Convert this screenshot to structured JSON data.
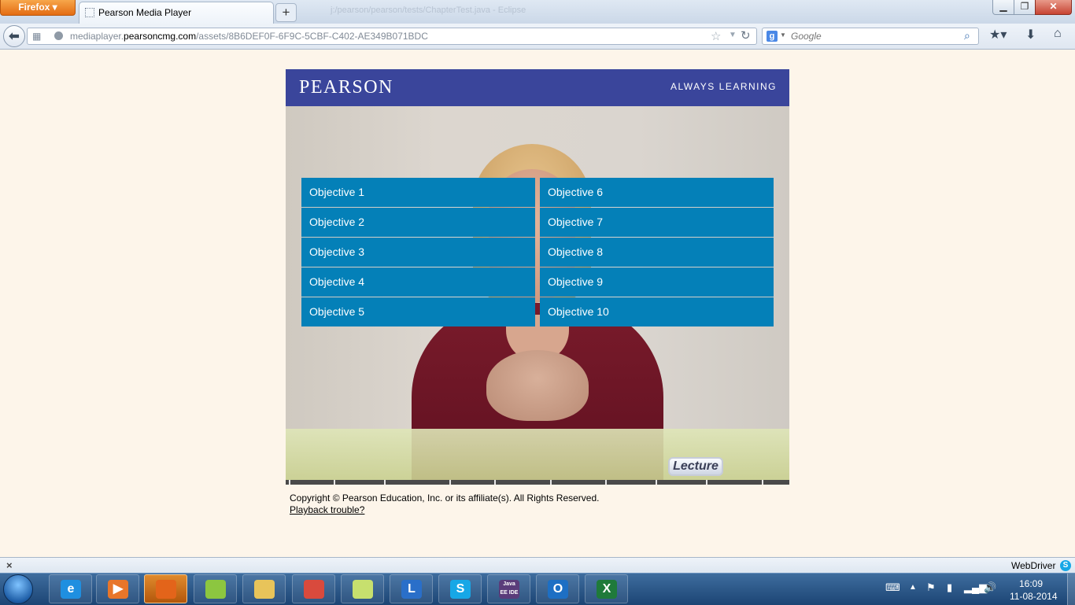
{
  "browser": {
    "menu_button": "Firefox",
    "tab_title": "Pearson Media Player",
    "new_tab": "+",
    "background_title": "j:/pearson/pearson/tests/ChapterTest.java - Eclipse",
    "url_prefix": "mediaplayer.",
    "url_domain": "pearsoncmg.com",
    "url_path": "/assets/8B6DEF0F-6F9C-5CBF-C402-AE349B071BDC",
    "search_placeholder": "Google",
    "search_engine_letter": "g"
  },
  "page": {
    "logo": "PEARSON",
    "tagline": "ALWAYS LEARNING",
    "objectives_left": [
      "Objective 1",
      "Objective 2",
      "Objective 3",
      "Objective 4",
      "Objective 5"
    ],
    "objectives_right": [
      "Objective 6",
      "Objective 7",
      "Objective 8",
      "Objective 9",
      "Objective 10"
    ],
    "video_badge": "Lecture",
    "copyright": "Copyright © Pearson Education, Inc. or its affiliate(s). All Rights Reserved.",
    "playback_link": "Playback trouble?",
    "colors": {
      "header": "#3a459b",
      "objective": "#0480b8",
      "page_bg": "#fdf5ea"
    }
  },
  "addon_bar": {
    "close": "×",
    "webdriver": "WebDriver",
    "skype_letter": "S"
  },
  "taskbar": {
    "items": [
      {
        "name": "internet-explorer",
        "letter": "e",
        "color": "#1f8fe0"
      },
      {
        "name": "media-player",
        "letter": "▶",
        "color": "#e8762a"
      },
      {
        "name": "firefox",
        "letter": "",
        "color": "#e3641a"
      },
      {
        "name": "android",
        "letter": "",
        "color": "#8cc640"
      },
      {
        "name": "file-explorer",
        "letter": "",
        "color": "#e8c45a"
      },
      {
        "name": "chrome",
        "letter": "",
        "color": "#d94a3d"
      },
      {
        "name": "sticky-notes",
        "letter": "",
        "color": "#c7e06e"
      },
      {
        "name": "lync",
        "letter": "L",
        "color": "#2a6fc9"
      },
      {
        "name": "skype",
        "letter": "S",
        "color": "#17a7e6"
      },
      {
        "name": "java-ee-ide",
        "letter": "Java EE IDE",
        "color": "#5a3c7a"
      },
      {
        "name": "outlook",
        "letter": "O",
        "color": "#1d6fc4"
      },
      {
        "name": "excel",
        "letter": "X",
        "color": "#1f7a3a"
      }
    ],
    "clock_time": "16:09",
    "clock_date": "11-08-2014"
  }
}
